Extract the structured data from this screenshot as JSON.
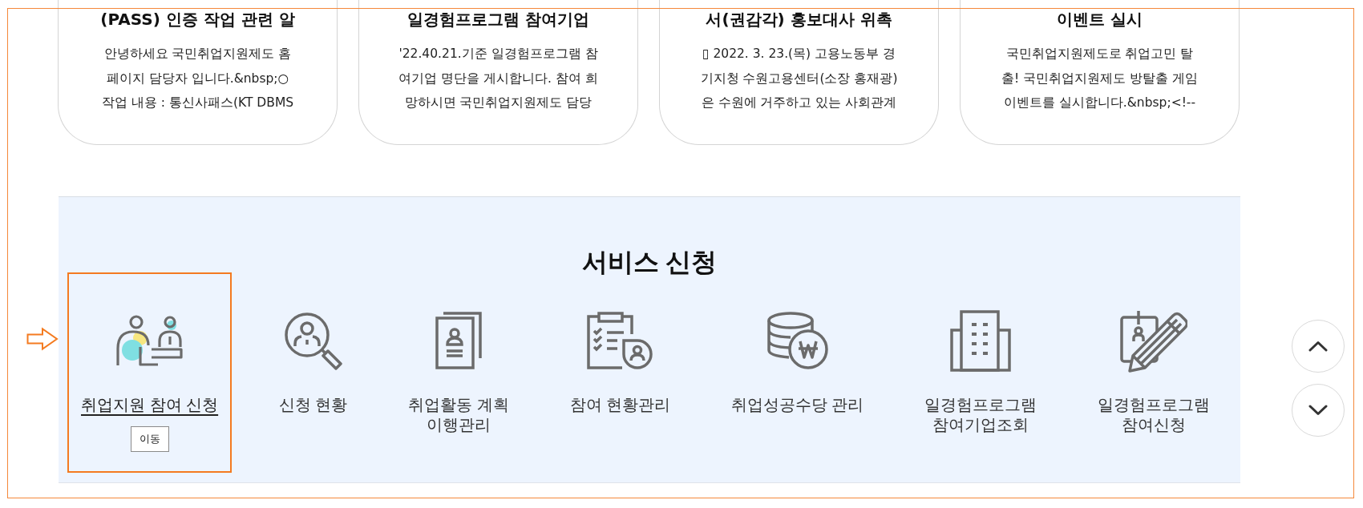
{
  "notice_cards": [
    {
      "title": "(PASS) 인증 작업 관련 알",
      "body": "안녕하세요 국민취업지원제도 홈\n페이지 담당자 입니다.&nbsp;○\n작업 내용 : 통신사패스(KT DBMS"
    },
    {
      "title": "일경험프로그램 참여기업",
      "body": "'22.40.21.기준 일경험프로그램 참\n여기업 명단을 게시합니다. 참여 희\n망하시면 국민취업지원제도 담당"
    },
    {
      "title": "서(권감각) 홍보대사 위촉",
      "body": "▯ 2022. 3. 23.(목) 고용노동부 경\n기지청 수원고용센터(소장 홍재광)\n은 수원에 거주하고 있는 사회관계"
    },
    {
      "title": "이벤트 실시",
      "body": "국민취업지원제도로 취업고민 탈\n출! 국민취업지원제도 방탈출 게임\n이벤트를 실시합니다.&nbsp;<!--"
    }
  ],
  "service_section": {
    "title": "서비스 신청",
    "items": [
      {
        "label": "취업지원 참여 신청",
        "selected": true,
        "action": "이동"
      },
      {
        "label": "신청 현황",
        "selected": false
      },
      {
        "label": "취업활동 계획\n이행관리",
        "selected": false
      },
      {
        "label": "참여 현황관리",
        "selected": false
      },
      {
        "label": "취업성공수당 관리",
        "selected": false
      },
      {
        "label": "일경험프로그램\n참여기업조회",
        "selected": false
      },
      {
        "label": "일경험프로그램\n참여신청",
        "selected": false
      }
    ]
  }
}
